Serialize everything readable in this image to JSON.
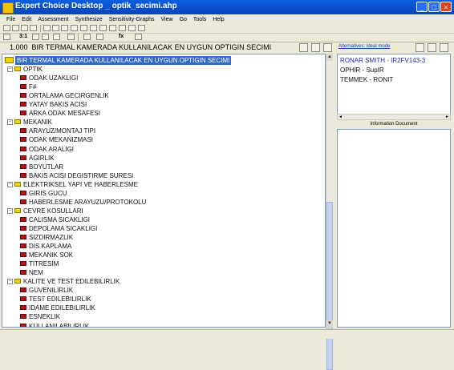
{
  "window": {
    "title": "Expert Choice Desktop _ optik_secimi.ahp"
  },
  "menu": [
    "File",
    "Edit",
    "Assessment",
    "Synthesize",
    "Sensitivity-Graphs",
    "View",
    "Go",
    "Tools",
    "Help"
  ],
  "toolbar": {
    "level_label": "3:1",
    "fx_label": "fx"
  },
  "goal": {
    "priority": "1.000",
    "text": "BIR TERMAL KAMERADA KULLANILACAK EN UYGUN OPTIGIN SECIMI"
  },
  "tree": {
    "root": "BIR TERMAL KAMERADA KULLANILACAK EN UYGUN OPTIGIN SECIMI",
    "groups": [
      {
        "label": "OPTIK",
        "children": [
          "ODAK UZAKLIGI",
          "F#",
          "ORTALAMA GECIRGENLIK",
          "YATAY BAKIS ACISI",
          "ARKA ODAK MESAFESI"
        ]
      },
      {
        "label": "MEKANIK",
        "children": [
          "ARAYUZ/MONTAJ TIPI",
          "ODAK MEKANIZMASI",
          "ODAK ARALIGI",
          "AGIRLIK",
          "BOYUTLAR",
          "BAKIS ACISI DEGISTIRME SURESI"
        ]
      },
      {
        "label": "ELEKTRIKSEL YAPI VE HABERLESME",
        "children": [
          "GIRIS GUCU",
          "HABERLESME ARAYUZU/PROTOKOLU"
        ]
      },
      {
        "label": "CEVRE KOSULLARI",
        "children": [
          "CALISMA SICAKLIGI",
          "DEPOLAMA SICAKLIGI",
          "SIZDIRMAZLIK",
          "DIS KAPLAMA",
          "MEKANIK SOK",
          "TITRESIM",
          "NEM"
        ]
      },
      {
        "label": "KALITE VE TEST EDILEBILIRLIK",
        "children": [
          "GUVENILIRLIK",
          "TEST EDILEBILIRLIK",
          "IDAME EDILEBILIRLIK",
          "ESNEKLIK",
          "KULLANILABILIRLIK"
        ]
      }
    ]
  },
  "alternatives": {
    "header": "Alternatives: Ideal mode",
    "items": [
      "RONAR SMITH - IR2FV143-3",
      "OPHIR - SupIR",
      "TEMMEK - RONIT"
    ],
    "item_colors": [
      "#1a2fb0",
      "#111111",
      "#111111"
    ]
  },
  "info": {
    "label": "Information Document"
  },
  "colors": {
    "titlebar": "#0a5fe0",
    "selection": "#316ac5",
    "group_marker": "#f2d200",
    "leaf_marker": "#b01818"
  }
}
